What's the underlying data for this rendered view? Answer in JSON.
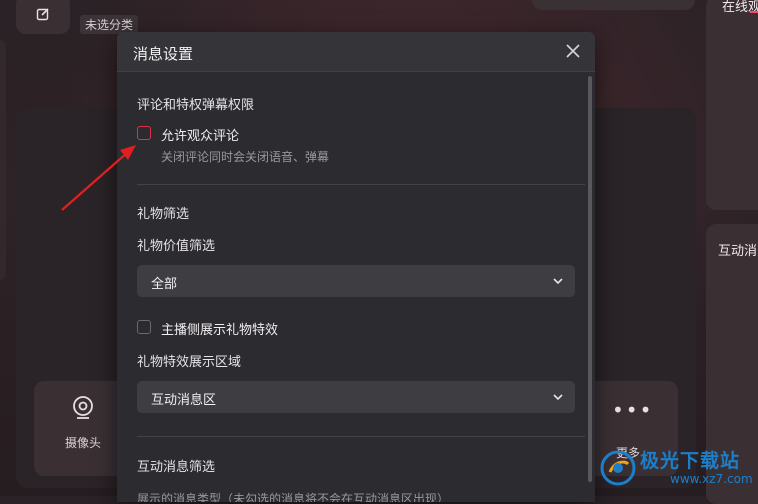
{
  "background": {
    "tag_uncategorized": "未选分类",
    "right_panel_top_label": "在线观",
    "right_panel_bottom_label": "互动消",
    "bottom_bar": {
      "camera_label": "摄像头",
      "more_label": "更多"
    }
  },
  "dialog": {
    "title": "消息设置",
    "sections": {
      "comment_permission": {
        "title": "评论和特权弹幕权限",
        "allow_comments_label": "允许观众评论",
        "allow_comments_desc": "关闭评论同时会关闭语音、弹幕",
        "allow_comments_checked": false
      },
      "gift_filter": {
        "title": "礼物筛选",
        "value_filter_label": "礼物价值筛选",
        "value_filter_selected": "全部",
        "show_effects_label": "主播侧展示礼物特效",
        "show_effects_checked": false,
        "effects_area_label": "礼物特效展示区域",
        "effects_area_selected": "互动消息区"
      },
      "interactive_filter": {
        "title": "互动消息筛选",
        "partial_desc": "展示的消息类型（未勾选的消息将不会在互动消息区出现）"
      }
    }
  },
  "watermark": {
    "brand": "极光下载站",
    "url": "www.xz7.com"
  },
  "colors": {
    "highlight_red": "#e0304b",
    "arrow_red": "#e02020",
    "watermark_blue": "#1d7fc9"
  }
}
